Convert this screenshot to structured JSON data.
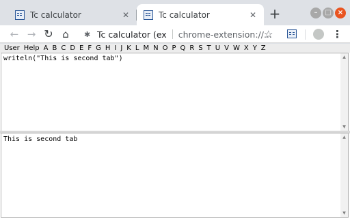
{
  "tabs": [
    {
      "title": "Tc calculator",
      "active": false
    },
    {
      "title": "Tc calculator",
      "active": true
    }
  ],
  "icons": {
    "close": "✕",
    "new_tab": "+",
    "back": "←",
    "forward": "→",
    "reload": "↻",
    "home": "⌂",
    "puzzle": "✱",
    "star": "☆",
    "menu": "⋮",
    "minimize": "–",
    "maximize": "□",
    "window_close": "×",
    "scroll_up": "▲",
    "scroll_down": "▼"
  },
  "omnibox": {
    "title": "Tc calculator (ex",
    "url": "chrome-extension://..."
  },
  "menu": [
    "User",
    "Help",
    "A",
    "B",
    "C",
    "D",
    "E",
    "F",
    "G",
    "H",
    "I",
    "J",
    "K",
    "L",
    "M",
    "N",
    "O",
    "P",
    "Q",
    "R",
    "S",
    "T",
    "U",
    "V",
    "W",
    "X",
    "Y",
    "Z"
  ],
  "editor": {
    "code": "writeln(\"This is second tab\")"
  },
  "output": {
    "text": "This is second tab"
  },
  "colors": {
    "tabstrip_bg": "#dee1e6",
    "window_close": "#e95420",
    "menubar_bg": "#ececec"
  }
}
